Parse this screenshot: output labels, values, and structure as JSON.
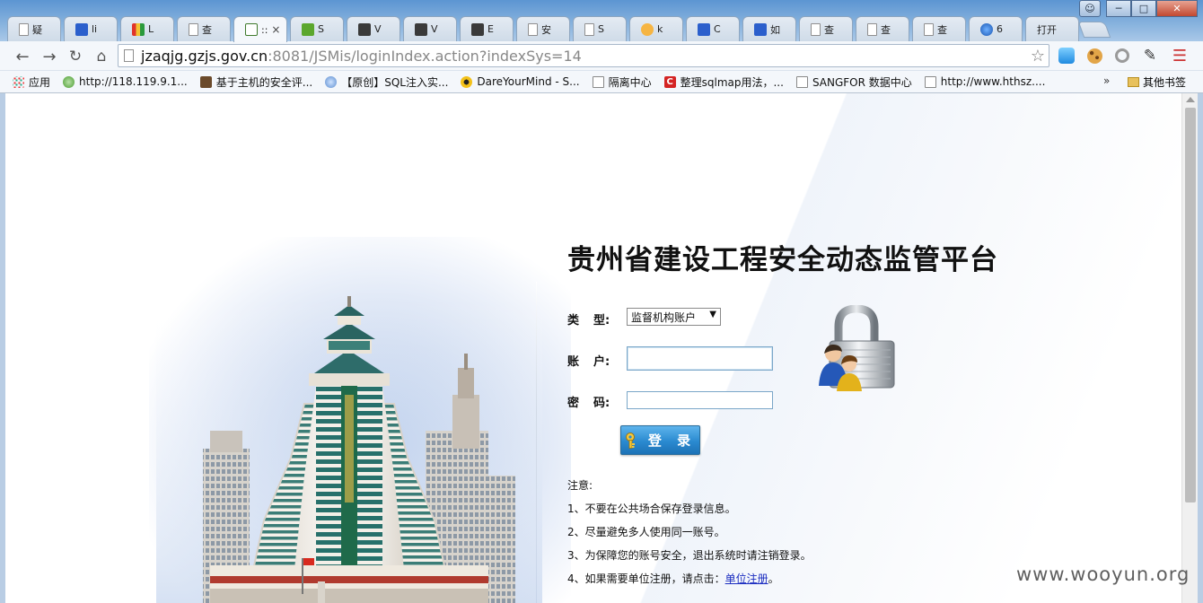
{
  "browser": {
    "tabs": [
      {
        "label": "疑",
        "icon": "doc"
      },
      {
        "label": "li",
        "icon": "paw"
      },
      {
        "label": "L",
        "icon": "multi"
      },
      {
        "label": "查",
        "icon": "doc"
      },
      {
        "label": "::",
        "icon": "gzjs",
        "active": true
      },
      {
        "label": "S",
        "icon": "green"
      },
      {
        "label": "V",
        "icon": "dark"
      },
      {
        "label": "V",
        "icon": "dark"
      },
      {
        "label": "E",
        "icon": "dark"
      },
      {
        "label": "安",
        "icon": "doc"
      },
      {
        "label": "S",
        "icon": "doc"
      },
      {
        "label": "k",
        "icon": "cloud"
      },
      {
        "label": "C",
        "icon": "paw"
      },
      {
        "label": "如",
        "icon": "paw"
      },
      {
        "label": "查",
        "icon": "doc"
      },
      {
        "label": "查",
        "icon": "doc"
      },
      {
        "label": "查",
        "icon": "doc"
      },
      {
        "label": "6",
        "icon": "globe"
      },
      {
        "label": "打开",
        "icon": "none"
      }
    ],
    "tab_close_glyph": "×",
    "url_host": "jzaqjg.gzjs.gov.cn",
    "url_path": ":8081/JSMis/loginIndex.action?indexSys=14",
    "bookmarks": [
      {
        "label": "应用",
        "icon": "apps"
      },
      {
        "label": "http://118.119.9.1...",
        "icon": "round"
      },
      {
        "label": "基于主机的安全评...",
        "icon": "book"
      },
      {
        "label": "【原创】SQL注入实...",
        "icon": "snow"
      },
      {
        "label": "DareYourMind - S...",
        "icon": "rad"
      },
      {
        "label": "隔离中心",
        "icon": "page"
      },
      {
        "label": "整理sqlmap用法，...",
        "icon": "red"
      },
      {
        "label": "SANGFOR 数据中心",
        "icon": "page"
      },
      {
        "label": "http://www.hthsz....",
        "icon": "page"
      }
    ],
    "bookmarks_more": "»",
    "other_bookmarks": "其他书签"
  },
  "page": {
    "title": "贵州省建设工程安全动态监管平台",
    "type_label_1": "类",
    "type_label_2": "型:",
    "account_label_1": "账",
    "account_label_2": "户:",
    "password_label_1": "密",
    "password_label_2": "码:",
    "type_selected": "监督机构账户",
    "type_arrow": "▼",
    "account_value": "",
    "password_value": "",
    "login_button": "登 录",
    "notes_title": "注意:",
    "notes": [
      "1、不要在公共场合保存登录信息。",
      "2、尽量避免多人使用同一账号。",
      "3、为保障您的账号安全，退出系统时请注销登录。"
    ],
    "note4_text": "4、如果需要单位注册，请点击：",
    "note4_link": "单位注册",
    "note4_suffix": "。"
  },
  "watermark": "www.wooyun.org"
}
